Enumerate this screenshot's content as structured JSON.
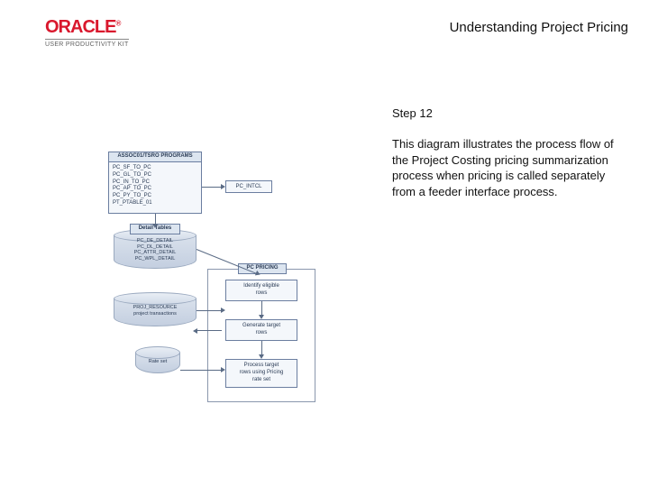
{
  "header": {
    "logo": "ORACLE",
    "logo_sub": "USER PRODUCTIVITY KIT",
    "title": "Understanding Project Pricing"
  },
  "content": {
    "step": "Step 12",
    "description": "This diagram illustrates the process flow of the Project Costing pricing summarization process when pricing is called separately from a feeder interface process."
  },
  "diagram": {
    "progs_label": "ASSOC01/TSRO PROGRAMS",
    "progs_lines": "PC_SF_TO_PC\nPC_GL_TO_PC\nPC_IN_TO_PC\nPC_AP_TO_PC\nPC_PY_TO_PC\nPT_PTABLE_01",
    "pc_intcl": "PC_INTCL",
    "detail_label": "Detail Tables",
    "detail_lines": "PC_DE_DETAIL\nPC_DL_DETAIL\nPC_ATTR_DETAIL\nPC_WPL_DETAIL",
    "pricing_label": "PC PRICING",
    "step_identify": "Identify eligible\nrows",
    "step_generate": "Generate target\nrows",
    "step_process": "Process target\nrows using Pricing\nrate set",
    "transactions": "PROJ_RESOURCE\nproject transactions",
    "rateset": "Rate set"
  }
}
